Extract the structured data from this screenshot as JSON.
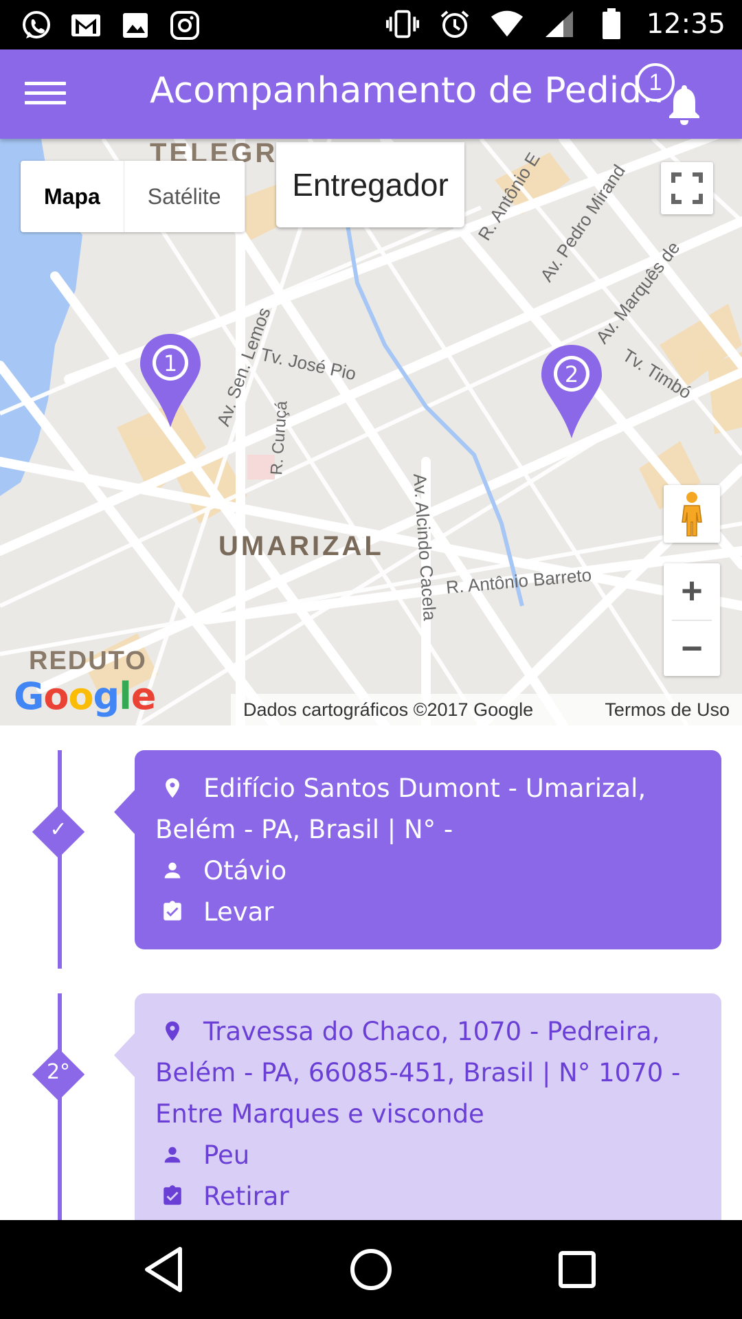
{
  "status_bar": {
    "time": "12:35",
    "left_icons": [
      "whatsapp-icon",
      "gmail-icon",
      "gallery-icon",
      "instagram-icon"
    ],
    "right_icons": [
      "vibrate-icon",
      "alarm-icon",
      "wifi-icon",
      "signal-icon",
      "battery-icon"
    ]
  },
  "app_bar": {
    "title": "Acompanhamento de Pedid..",
    "notification_count": "1",
    "accent_color": "#8b68e8"
  },
  "map": {
    "type_buttons": {
      "map": "Mapa",
      "satellite": "Satélite"
    },
    "entregador_label": "Entregador",
    "labels": {
      "telegrafo": "TELEGRA",
      "av_sen_lemos": "Av. Sen. Lemos",
      "tv_jose_pio": "Tv. José Pio",
      "r_curuca": "R. Curuçá",
      "umarizal": "UMARIZAL",
      "av_alcindo_cacela": "Av. Alcindo Cacela",
      "r_antonio_barreto": "R. Antônio Barreto",
      "r_antonio_e": "R. Antônio E",
      "av_pedro_miranda": "Av. Pedro Mirand",
      "av_marques": "Av. Marquês de",
      "tv_timbo": "Tv. Timbó",
      "reduto": "REDUTO"
    },
    "markers": [
      "1",
      "2"
    ],
    "google_logo": "Google",
    "attribution": "Dados cartográficos ©2017 Google",
    "terms": "Termos de Uso",
    "zoom_in": "+",
    "zoom_out": "−"
  },
  "timeline": [
    {
      "step": "✓",
      "status": "done",
      "address": "Edifício Santos Dumont - Umarizal, Belém - PA, Brasil | N° -",
      "person": "Otávio",
      "action": "Levar"
    },
    {
      "step": "2°",
      "status": "pending",
      "address": "Travessa do Chaco, 1070 - Pedreira, Belém - PA, 66085-451, Brasil | N° 1070 - Entre Marques e visconde",
      "person": "Peu",
      "action": "Retirar"
    }
  ],
  "nav_bar": {
    "buttons": [
      "back-icon",
      "home-icon",
      "recents-icon"
    ]
  }
}
